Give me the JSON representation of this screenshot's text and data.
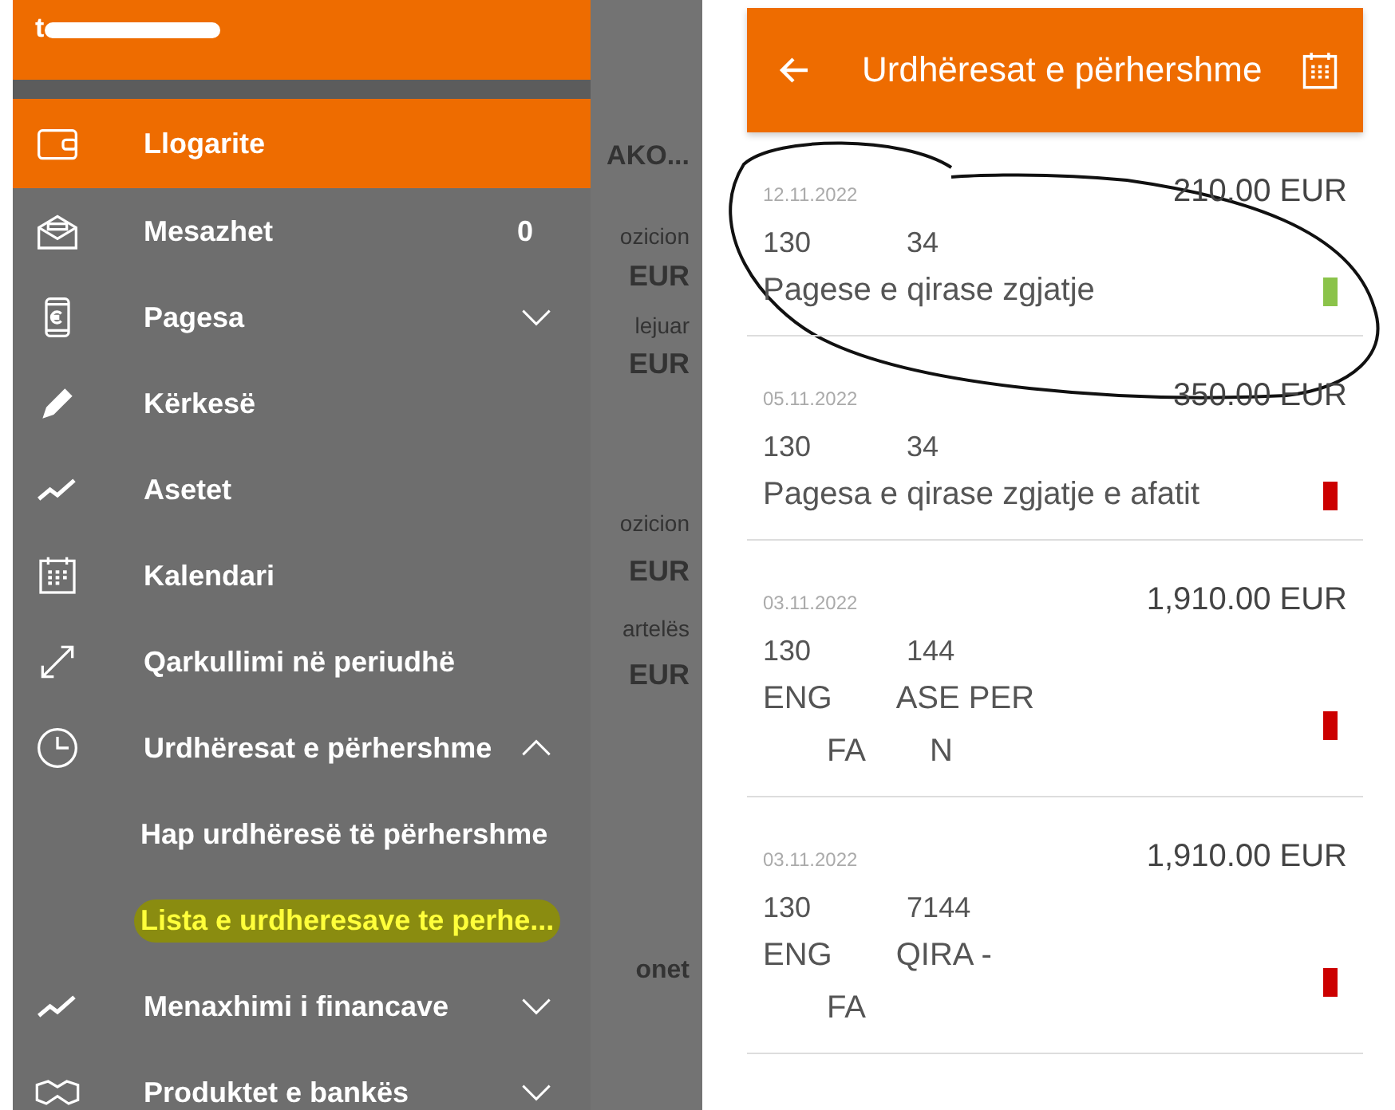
{
  "left_screen": {
    "drawer": {
      "user": "t",
      "items": [
        {
          "label": "Llogarite",
          "selected": true
        },
        {
          "label": "Mesazhet",
          "selected": false,
          "badge": "0"
        },
        {
          "label": "Pagesa",
          "selected": false,
          "expanded": false
        },
        {
          "label": "Kërkesë",
          "selected": false
        },
        {
          "label": "Asetet",
          "selected": false
        },
        {
          "label": "Kalendari",
          "selected": false
        },
        {
          "label": "Qarkullimi në periudhë",
          "selected": false
        },
        {
          "label": "Urdhëresat e përhershme",
          "selected": false,
          "expanded": true,
          "children": [
            {
              "label": "Hap urdhëresë të përhershme",
              "highlighted": false
            },
            {
              "label": "Lista e urdheresave te perhe...",
              "highlighted": true
            }
          ]
        },
        {
          "label": "Menaxhimi i financave",
          "selected": false,
          "expanded": false
        },
        {
          "label": "Produktet e bankës",
          "selected": false,
          "expanded": false
        }
      ]
    },
    "background_fragments": [
      "AKO...",
      "ozicion",
      "EUR",
      "lejuar",
      "EUR",
      "ozicion",
      "EUR",
      "artelës",
      "EUR",
      "onet"
    ]
  },
  "right_screen": {
    "title": "Urdhëresat e përhershme",
    "orders": [
      {
        "date": "12.11.2022",
        "amount": "210.00 EUR",
        "account": [
          "130",
          "34"
        ],
        "description": [
          "Pagese e qirase zgjatje"
        ],
        "color": "#8bc34a",
        "circled": true
      },
      {
        "date": "05.11.2022",
        "amount": "350.00 EUR",
        "account": [
          "130",
          "34"
        ],
        "description": [
          "Pagesa e qirase zgjatje e afatit"
        ],
        "color": "#cc0000",
        "circled": false
      },
      {
        "date": "03.11.2022",
        "amount": "1,910.00 EUR",
        "account": [
          "130",
          "144"
        ],
        "description": [
          "ENG",
          "ASE PER",
          "FA",
          "N"
        ],
        "color": "#cc0000",
        "circled": false
      },
      {
        "date": "03.11.2022",
        "amount": "1,910.00 EUR",
        "account": [
          "130",
          "7144"
        ],
        "description": [
          "ENG",
          "QIRA -",
          "FA"
        ],
        "color": "#cc0000",
        "circled": false
      }
    ]
  }
}
